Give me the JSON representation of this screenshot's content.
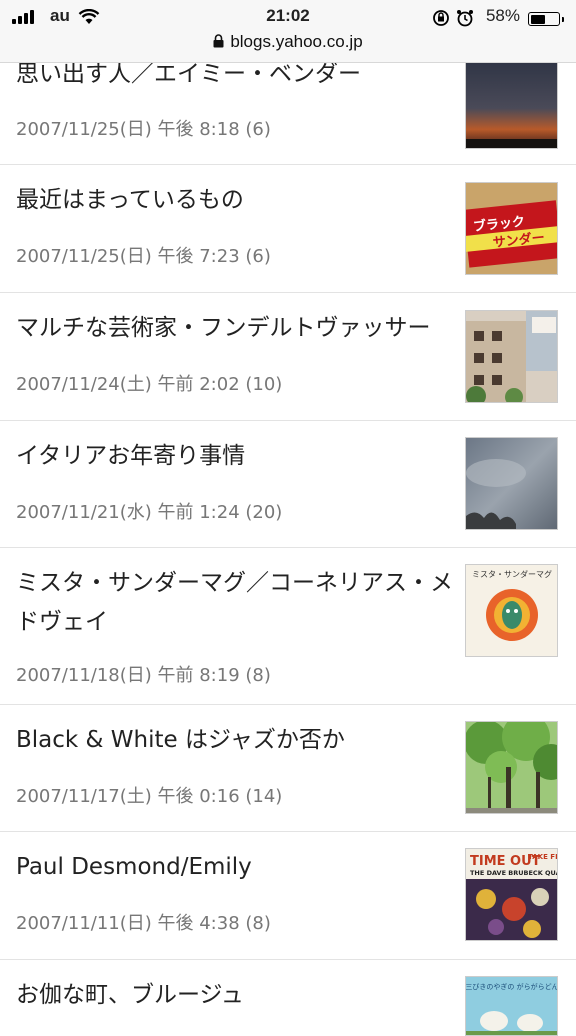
{
  "status_bar": {
    "carrier": "au",
    "time": "21:02",
    "battery": "58%",
    "battery_level": 0.58
  },
  "browser": {
    "url": "blogs.yahoo.co.jp"
  },
  "posts": [
    {
      "title": "思い出す人／エイミー・ベンダー",
      "meta": "2007/11/25(日) 午後 8:18 (6)"
    },
    {
      "title": "最近はまっているもの",
      "meta": "2007/11/25(日) 午後 7:23 (6)"
    },
    {
      "title": "マルチな芸術家・フンデルトヴァッサー",
      "meta": "2007/11/24(土) 午前 2:02 (10)"
    },
    {
      "title": "イタリアお年寄り事情",
      "meta": "2007/11/21(水) 午前 1:24 (20)"
    },
    {
      "title": "ミスタ・サンダーマグ／コーネリアス・メドヴェイ",
      "meta": "2007/11/18(日) 午前 8:19 (8)"
    },
    {
      "title": "Black & White はジャズか否か",
      "meta": "2007/11/17(土) 午後 0:16 (14)"
    },
    {
      "title": "Paul Desmond/Emily",
      "meta": "2007/11/11(日) 午後 4:38 (8)"
    },
    {
      "title": "お伽な町、ブルージュ",
      "meta": ""
    }
  ],
  "thumb_text": {
    "chocolate_line1": "ブラック",
    "chocolate_line2": "サンダー",
    "book_title": "ミスタ・サンダーマグ",
    "album_title": "TIME OUT",
    "album_sub": "TAKE FIVE",
    "album_artist": "THE DAVE BRUBECK QUARTET",
    "picturebook_title": "三びきのやぎの がらがらどん"
  }
}
